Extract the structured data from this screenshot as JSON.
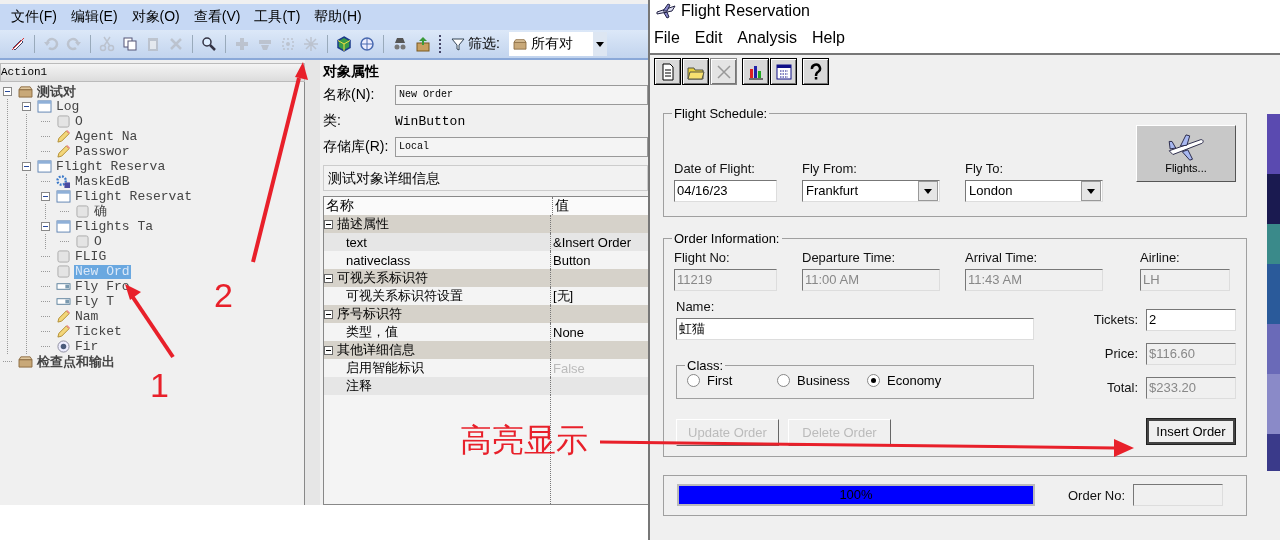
{
  "object_repository": {
    "menu": [
      "文件(F)",
      "编辑(E)",
      "对象(O)",
      "查看(V)",
      "工具(T)",
      "帮助(H)"
    ],
    "toolbar": [
      {
        "kind": "erase",
        "disabled": false
      },
      {
        "kind": "undo",
        "disabled": true
      },
      {
        "kind": "redo",
        "disabled": true
      },
      {
        "kind": "cut",
        "disabled": true
      },
      {
        "kind": "copy",
        "disabled": false
      },
      {
        "kind": "paste",
        "disabled": true
      },
      {
        "kind": "delete",
        "disabled": true
      },
      {
        "kind": "find",
        "disabled": false
      },
      {
        "kind": "add",
        "disabled": true
      },
      {
        "kind": "remove",
        "disabled": true
      },
      {
        "kind": "select",
        "disabled": true
      },
      {
        "kind": "star",
        "disabled": true
      },
      {
        "kind": "highlight",
        "disabled": false
      },
      {
        "kind": "locate",
        "disabled": false
      },
      {
        "kind": "spy",
        "disabled": false
      },
      {
        "kind": "export",
        "disabled": false
      }
    ],
    "filter": {
      "label": "筛选:",
      "value": "所有对"
    },
    "action": "Action1",
    "tree": [
      {
        "label": "测试对",
        "kind": "folder",
        "selected": false,
        "expanded": true,
        "children": [
          {
            "label": "Log",
            "kind": "window",
            "selected": false,
            "expanded": true,
            "children": [
              {
                "label": "O",
                "kind": "button",
                "selected": false
              },
              {
                "label": "Agent Na",
                "kind": "edit",
                "selected": false
              },
              {
                "label": "Passwor",
                "kind": "edit",
                "selected": false
              }
            ]
          },
          {
            "label": "Flight Reserva",
            "kind": "window",
            "selected": false,
            "expanded": true,
            "children": [
              {
                "label": "MaskEdB",
                "kind": "activex",
                "selected": false
              },
              {
                "label": "Flight Reservat",
                "kind": "window",
                "selected": false,
                "expanded": true,
                "children": [
                  {
                    "label": "确",
                    "kind": "button",
                    "selected": false
                  }
                ]
              },
              {
                "label": "Flights Ta",
                "kind": "window",
                "selected": false,
                "expanded": true,
                "children": [
                  {
                    "label": "O",
                    "kind": "button",
                    "selected": false
                  }
                ]
              },
              {
                "label": "FLIG",
                "kind": "button",
                "selected": false
              },
              {
                "label": "New Ord",
                "kind": "button",
                "selected": true
              },
              {
                "label": "Fly Fro",
                "kind": "combo",
                "selected": false
              },
              {
                "label": "Fly T",
                "kind": "combo",
                "selected": false
              },
              {
                "label": "Nam",
                "kind": "edit",
                "selected": false
              },
              {
                "label": "Ticket",
                "kind": "edit",
                "selected": false
              },
              {
                "label": "Fir",
                "kind": "radio",
                "selected": false
              }
            ]
          }
        ]
      },
      {
        "label": "检查点和输出",
        "kind": "folder",
        "selected": false
      }
    ],
    "properties": {
      "title": "对象属性",
      "name_label": "名称(N):",
      "name_value": "New Order",
      "class_label": "类:",
      "class_value": "WinButton",
      "repository_label": "存储库(R):",
      "repository_value": "Local",
      "details_title": "测试对象详细信息",
      "columns": [
        "名称",
        "值"
      ],
      "rows": [
        {
          "kind": "group",
          "name": "描述属性",
          "expanded": true
        },
        {
          "kind": "prop",
          "name": "text",
          "value": "&Insert Order"
        },
        {
          "kind": "prop",
          "name": "nativeclass",
          "value": "Button"
        },
        {
          "kind": "group",
          "name": "可视关系标识符",
          "expanded": true
        },
        {
          "kind": "prop",
          "name": "可视关系标识符设置",
          "value": "[无]"
        },
        {
          "kind": "group",
          "name": "序号标识符",
          "expanded": true
        },
        {
          "kind": "prop",
          "name": "类型，值",
          "value": "None"
        },
        {
          "kind": "group",
          "name": "其他详细信息",
          "expanded": true
        },
        {
          "kind": "prop",
          "name": "启用智能标识",
          "value": "False",
          "disabled": true
        },
        {
          "kind": "prop",
          "name": "注释"
        }
      ]
    }
  },
  "flight_window": {
    "title": "Flight Reservation",
    "menu": [
      "File",
      "Edit",
      "Analysis",
      "Help"
    ],
    "toolbar": [
      {
        "kind": "new",
        "disabled": false
      },
      {
        "kind": "open",
        "disabled": false
      },
      {
        "kind": "delete",
        "disabled": true
      },
      {
        "kind": "chart",
        "disabled": false
      },
      {
        "kind": "calendar",
        "disabled": false
      },
      {
        "kind": "help",
        "disabled": false
      }
    ],
    "flight_schedule": {
      "title": "Flight Schedule:",
      "date_label": "Date of Flight:",
      "date_value": "04/16/23",
      "from_label": "Fly From:",
      "from_value": "Frankfurt",
      "to_label": "Fly To:",
      "to_value": "London",
      "flights_button": "Flights..."
    },
    "order_information": {
      "title": "Order Information:",
      "fields": [
        {
          "label": "Flight No:",
          "value": "11219",
          "disabled": true
        },
        {
          "label": "Departure Time:",
          "value": "11:00 AM",
          "disabled": true
        },
        {
          "label": "Arrival Time:",
          "value": "11:43 AM",
          "disabled": true
        },
        {
          "label": "Airline:",
          "value": "LH",
          "disabled": true
        }
      ],
      "name_label": "Name:",
      "name_value": "虹猫",
      "tickets_label": "Tickets:",
      "tickets_value": "2",
      "class_title": "Class:",
      "class_options": [
        {
          "label": "First",
          "selected": false
        },
        {
          "label": "Business",
          "selected": false
        },
        {
          "label": "Economy",
          "selected": true
        }
      ],
      "price_label": "Price:",
      "price_value": "$116.60",
      "total_label": "Total:",
      "total_value": "$233.20",
      "buttons": [
        {
          "label": "Update Order",
          "disabled": true,
          "focused": false
        },
        {
          "label": "Delete Order",
          "disabled": true,
          "focused": false
        },
        {
          "label": "Insert Order",
          "disabled": false,
          "focused": true
        }
      ]
    },
    "progress": {
      "level": 1,
      "reading": "100%"
    },
    "order_no_label": "Order No:"
  },
  "annotations": [
    {
      "text": "1"
    },
    {
      "text": "2"
    },
    {
      "text": "高亮显示"
    }
  ]
}
